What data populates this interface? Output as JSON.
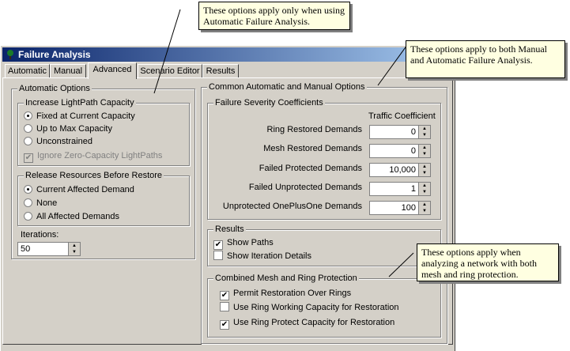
{
  "window": {
    "title": "Failure Analysis"
  },
  "tabs": [
    {
      "label": "Automatic"
    },
    {
      "label": "Manual"
    },
    {
      "label": "Advanced"
    },
    {
      "label": "Scenario Editor"
    },
    {
      "label": "Results"
    }
  ],
  "automatic_options": {
    "title": "Automatic Options",
    "lightpath": {
      "title": "Increase LightPath Capacity",
      "options": [
        "Fixed at Current Capacity",
        "Up to Max Capacity",
        "Unconstrained"
      ],
      "selected_index": 0,
      "ignore_zero_label": "Ignore Zero-Capacity LightPaths"
    },
    "release": {
      "title": "Release Resources Before Restore",
      "options": [
        "Current Affected Demand",
        "None",
        "All Affected Demands"
      ],
      "selected_index": 0
    },
    "iterations_label": "Iterations:",
    "iterations_value": "50"
  },
  "common_options": {
    "title": "Common Automatic and Manual Options",
    "severity": {
      "title": "Failure Severity Coefficients",
      "column_header": "Traffic Coefficient",
      "rows": [
        {
          "label": "Ring Restored Demands",
          "value": "0"
        },
        {
          "label": "Mesh Restored Demands",
          "value": "0"
        },
        {
          "label": "Failed Protected Demands",
          "value": "10,000"
        },
        {
          "label": "Failed Unprotected Demands",
          "value": "1"
        },
        {
          "label": "Unprotected OnePlusOne Demands",
          "value": "100"
        }
      ]
    },
    "results": {
      "title": "Results",
      "show_paths_label": "Show Paths",
      "show_paths_checked": true,
      "show_iteration_label": "Show Iteration Details",
      "show_iteration_checked": false
    },
    "combined": {
      "title": "Combined Mesh and Ring Protection",
      "items": [
        {
          "label": "Permit Restoration Over Rings",
          "checked": true
        },
        {
          "label": "Use Ring Working Capacity for Restoration",
          "checked": false
        },
        {
          "label": "Use Ring Protect Capacity for Restoration",
          "checked": true
        }
      ]
    }
  },
  "callouts": {
    "automatic_only": "These options apply only when using Automatic Failure Analysis.",
    "both": "These options apply to both Manual and Automatic Failure Analysis.",
    "mesh_ring": "These options apply when analyzing a network with both mesh and ring protection."
  },
  "glyphs": {
    "check": "✔",
    "up": "▲",
    "down": "▼"
  }
}
